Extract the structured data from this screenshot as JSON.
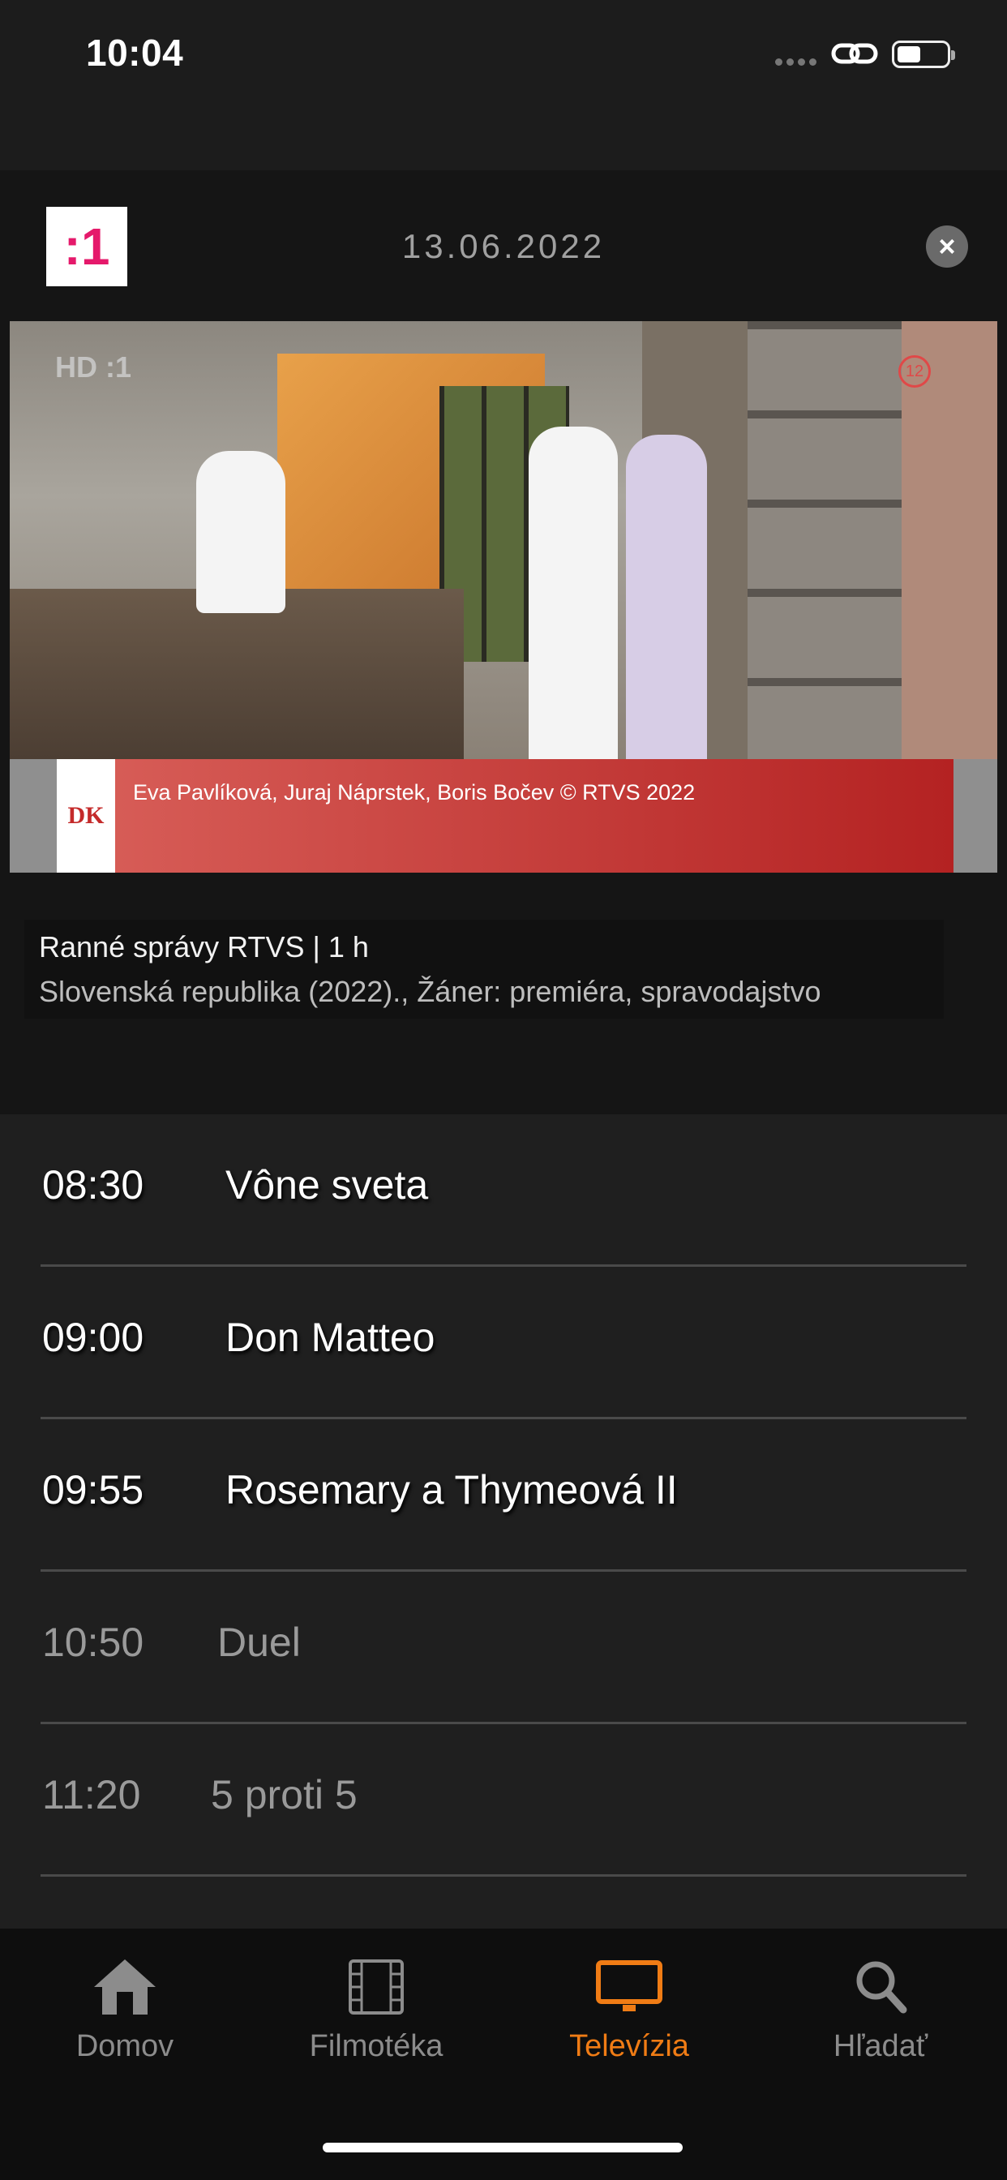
{
  "status_bar": {
    "time": "10:04"
  },
  "header": {
    "channel_logo": ":1",
    "date": "13.06.2022",
    "close_icon": "×"
  },
  "video": {
    "hd_badge": "HD :1",
    "age_rating": "12",
    "lower_third_logo": "DK",
    "lower_third_text": "Eva Pavlíková, Juraj Náprstek, Boris Bočev  © RTVS 2022"
  },
  "program": {
    "title": "Ranné správy RTVS | 1 h",
    "meta": "Slovenská republika (2022)., Žáner: premiéra, spravodajstvo"
  },
  "schedule": [
    {
      "time": "08:30",
      "title": "Vône sveta"
    },
    {
      "time": "09:00",
      "title": "Don Matteo"
    },
    {
      "time": "09:55",
      "title": "Rosemary a Thymeová II"
    },
    {
      "time": "10:50",
      "title": "Duel"
    },
    {
      "time": "11:20",
      "title": "5 proti 5"
    }
  ],
  "tabbar": {
    "home": "Domov",
    "films": "Filmotéka",
    "tv": "Televízia",
    "search": "Hľadať"
  },
  "colors": {
    "accent": "#f07c15",
    "channel_pink": "#e5196b",
    "background": "#1c1c1c"
  }
}
